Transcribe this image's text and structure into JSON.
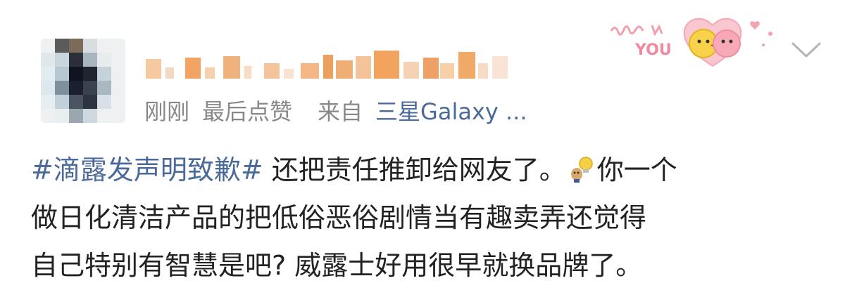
{
  "post": {
    "meta": {
      "time": "刚刚",
      "action": "最后点赞",
      "from_label": "来自",
      "source": "三星Galaxy ..."
    },
    "sticker_text": "YOU",
    "content": {
      "hashtag": "#滴露发声明致歉#",
      "line1_rest": " 还把责任推卸给网友了。",
      "line1_tail": "你一个",
      "line2": "做日化清洁产品的把低俗恶俗剧情当有趣卖弄还觉得",
      "line3": "自己特别有智慧是吧? 威露士好用很早就换品牌了。"
    },
    "icons": {
      "avatar": "pixelated-avatar",
      "chevron": "chevron-down-icon",
      "inline_emoji": "doge-lightbulb-emoji",
      "sticker": "kiss-sticker"
    }
  }
}
